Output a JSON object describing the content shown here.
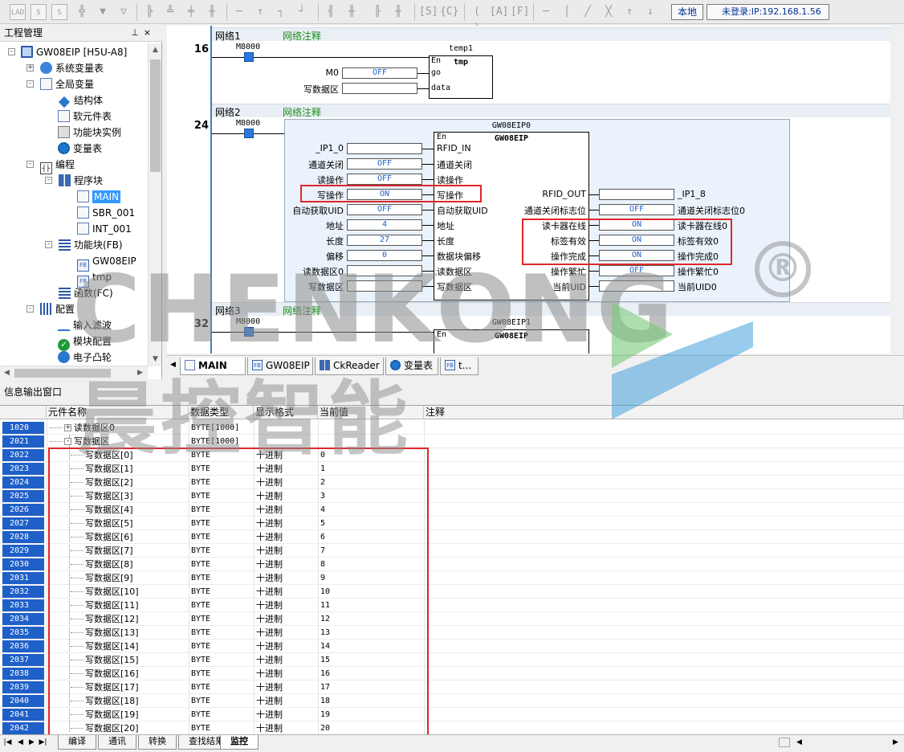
{
  "toolbar": {
    "local_label": "本地",
    "login_label": "未登录:IP:192.168.1.56"
  },
  "project_panel": {
    "title": "工程管理",
    "tree": [
      {
        "label": "GW08EIP [H5U-A8]",
        "icon": "computer-icon"
      },
      {
        "label": "系统变量表",
        "icon": "globe-icon"
      },
      {
        "label": "全局变量",
        "icon": "document-icon"
      },
      {
        "label": "结构体",
        "icon": "diamond-icon"
      },
      {
        "label": "软元件表",
        "icon": "document-icon"
      },
      {
        "label": "功能块实例",
        "icon": "cube-icon"
      },
      {
        "label": "变量表",
        "icon": "gear-icon"
      },
      {
        "label": "编程",
        "icon": "program-icon"
      },
      {
        "label": "程序块",
        "icon": "grid-icon"
      },
      {
        "label": "MAIN",
        "icon": "ladder-icon"
      },
      {
        "label": "SBR_001",
        "icon": "ladder-icon"
      },
      {
        "label": "INT_001",
        "icon": "ladder-icon"
      },
      {
        "label": "功能块(FB)",
        "icon": "list-icon"
      },
      {
        "label": "GW08EIP",
        "icon": "fb-icon"
      },
      {
        "label": "tmp",
        "icon": "fb-icon"
      },
      {
        "label": "函数(FC)",
        "icon": "list-icon"
      },
      {
        "label": "配置",
        "icon": "config-icon"
      },
      {
        "label": "输入滤波",
        "icon": "filter-icon"
      },
      {
        "label": "模块配置",
        "icon": "check-icon"
      },
      {
        "label": "电子凸轮",
        "icon": "cam-icon"
      }
    ]
  },
  "ladder": {
    "networks": [
      {
        "title": "网络1",
        "comment": "网络注释",
        "rung": "16"
      },
      {
        "title": "网络2",
        "comment": "网络注释",
        "rung": "24"
      },
      {
        "title": "网络3",
        "comment": "网络注释",
        "rung": "32"
      }
    ],
    "contact_label": "M8000",
    "block1": {
      "instance": "temp1",
      "type": "tmp",
      "en": "En",
      "inputs": [
        {
          "var": "M0",
          "value": "OFF",
          "pin": "go"
        },
        {
          "var": "写数据区",
          "value": "",
          "pin": "data"
        }
      ]
    },
    "block2": {
      "instance": "GW08EIP0",
      "type": "GW08EIP",
      "en": "En",
      "inputs": [
        {
          "var": "_IP1_0",
          "value": "",
          "pin": "RFID_IN"
        },
        {
          "var": "通道关闭",
          "value": "OFF",
          "pin": "通道关闭"
        },
        {
          "var": "读操作",
          "value": "OFF",
          "pin": "读操作"
        },
        {
          "var": "写操作",
          "value": "ON",
          "pin": "写操作"
        },
        {
          "var": "自动获取UID",
          "value": "OFF",
          "pin": "自动获取UID"
        },
        {
          "var": "地址",
          "value": "4",
          "pin": "地址"
        },
        {
          "var": "长度",
          "value": "27",
          "pin": "长度"
        },
        {
          "var": "偏移",
          "value": "0",
          "pin": "数据块偏移"
        },
        {
          "var": "读数据区0",
          "value": "",
          "pin": "读数据区"
        },
        {
          "var": "写数据区",
          "value": "",
          "pin": "写数据区"
        }
      ],
      "outputs": [
        {
          "pin": "RFID_OUT",
          "value": "",
          "var": "_IP1_8"
        },
        {
          "pin": "通道关闭标志位",
          "value": "OFF",
          "var": "通道关闭标志位0"
        },
        {
          "pin": "读卡器在线",
          "value": "ON",
          "var": "读卡器在线0"
        },
        {
          "pin": "标签有效",
          "value": "ON",
          "var": "标签有效0"
        },
        {
          "pin": "操作完成",
          "value": "ON",
          "var": "操作完成0"
        },
        {
          "pin": "操作繁忙",
          "value": "OFF",
          "var": "操作繁忙0"
        },
        {
          "pin": "当前UID",
          "value": "",
          "var": "当前UID0"
        }
      ]
    },
    "block3": {
      "instance": "GW08EIP1",
      "type": "GW08EIP",
      "en": "En"
    }
  },
  "tabs": [
    {
      "label": "MAIN",
      "active": true
    },
    {
      "label": "GW08EIP"
    },
    {
      "label": "CkReader"
    },
    {
      "label": "变量表"
    },
    {
      "label": "t..."
    }
  ],
  "info_window": {
    "title": "信息输出窗口",
    "columns": [
      "元件名称",
      "数据类型",
      "显示格式",
      "当前值",
      "注释"
    ],
    "rows": [
      {
        "num": "1020",
        "name": "读数据区0",
        "type": "BYTE[1000]",
        "format": "",
        "value": "",
        "level": 0,
        "exp": "+"
      },
      {
        "num": "2021",
        "name": "写数据区",
        "type": "BYTE[1000]",
        "format": "",
        "value": "",
        "level": 0,
        "exp": "-"
      },
      {
        "num": "2022",
        "name": "写数据区[0]",
        "type": "BYTE",
        "format": "十进制",
        "value": "0",
        "level": 1
      },
      {
        "num": "2023",
        "name": "写数据区[1]",
        "type": "BYTE",
        "format": "十进制",
        "value": "1",
        "level": 1
      },
      {
        "num": "2024",
        "name": "写数据区[2]",
        "type": "BYTE",
        "format": "十进制",
        "value": "2",
        "level": 1
      },
      {
        "num": "2025",
        "name": "写数据区[3]",
        "type": "BYTE",
        "format": "十进制",
        "value": "3",
        "level": 1
      },
      {
        "num": "2026",
        "name": "写数据区[4]",
        "type": "BYTE",
        "format": "十进制",
        "value": "4",
        "level": 1
      },
      {
        "num": "2027",
        "name": "写数据区[5]",
        "type": "BYTE",
        "format": "十进制",
        "value": "5",
        "level": 1
      },
      {
        "num": "2028",
        "name": "写数据区[6]",
        "type": "BYTE",
        "format": "十进制",
        "value": "6",
        "level": 1
      },
      {
        "num": "2029",
        "name": "写数据区[7]",
        "type": "BYTE",
        "format": "十进制",
        "value": "7",
        "level": 1
      },
      {
        "num": "2030",
        "name": "写数据区[8]",
        "type": "BYTE",
        "format": "十进制",
        "value": "8",
        "level": 1
      },
      {
        "num": "2031",
        "name": "写数据区[9]",
        "type": "BYTE",
        "format": "十进制",
        "value": "9",
        "level": 1
      },
      {
        "num": "2032",
        "name": "写数据区[10]",
        "type": "BYTE",
        "format": "十进制",
        "value": "10",
        "level": 1
      },
      {
        "num": "2033",
        "name": "写数据区[11]",
        "type": "BYTE",
        "format": "十进制",
        "value": "11",
        "level": 1
      },
      {
        "num": "2034",
        "name": "写数据区[12]",
        "type": "BYTE",
        "format": "十进制",
        "value": "12",
        "level": 1
      },
      {
        "num": "2035",
        "name": "写数据区[13]",
        "type": "BYTE",
        "format": "十进制",
        "value": "13",
        "level": 1
      },
      {
        "num": "2036",
        "name": "写数据区[14]",
        "type": "BYTE",
        "format": "十进制",
        "value": "14",
        "level": 1
      },
      {
        "num": "2037",
        "name": "写数据区[15]",
        "type": "BYTE",
        "format": "十进制",
        "value": "15",
        "level": 1
      },
      {
        "num": "2038",
        "name": "写数据区[16]",
        "type": "BYTE",
        "format": "十进制",
        "value": "16",
        "level": 1
      },
      {
        "num": "2039",
        "name": "写数据区[17]",
        "type": "BYTE",
        "format": "十进制",
        "value": "17",
        "level": 1
      },
      {
        "num": "2040",
        "name": "写数据区[18]",
        "type": "BYTE",
        "format": "十进制",
        "value": "18",
        "level": 1
      },
      {
        "num": "2041",
        "name": "写数据区[19]",
        "type": "BYTE",
        "format": "十进制",
        "value": "19",
        "level": 1
      },
      {
        "num": "2042",
        "name": "写数据区[20]",
        "type": "BYTE",
        "format": "十进制",
        "value": "20",
        "level": 1
      }
    ]
  },
  "bottom_tabs": [
    {
      "label": "编译"
    },
    {
      "label": "通讯"
    },
    {
      "label": "转换"
    },
    {
      "label": "查找结果"
    },
    {
      "label": "监控",
      "active": true
    }
  ],
  "watermark": {
    "en": "CHENKONG",
    "cn": "晨控智能",
    "mark": "®"
  },
  "colors": {
    "selection": "#3399ff",
    "row_number_bg": "#1f5fc8",
    "highlight_border": "#e0262b",
    "comment_green": "#1a8c1a",
    "value_blue": "#1f5fc8"
  }
}
